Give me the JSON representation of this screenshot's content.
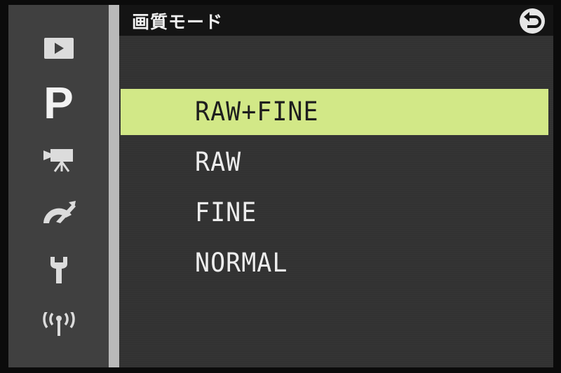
{
  "header": {
    "title": "画質モード",
    "back_icon": "return-arrow-icon"
  },
  "sidebar": {
    "items": [
      {
        "icon": "playback-icon"
      },
      {
        "icon": "shooting-mode-p-icon",
        "label": "P",
        "active": true
      },
      {
        "icon": "movie-camera-icon"
      },
      {
        "icon": "custom-settings-icon"
      },
      {
        "icon": "wrench-setup-icon"
      },
      {
        "icon": "wireless-antenna-icon"
      }
    ]
  },
  "menu": {
    "items": [
      {
        "label": "RAW+FINE",
        "selected": true
      },
      {
        "label": "RAW",
        "selected": false
      },
      {
        "label": "FINE",
        "selected": false
      },
      {
        "label": "NORMAL",
        "selected": false
      }
    ]
  },
  "colors": {
    "highlight": "#d2e887",
    "background": "#323232",
    "sidebar": "#404040",
    "divider": "#b9b9b9",
    "titlebar": "#141414"
  }
}
